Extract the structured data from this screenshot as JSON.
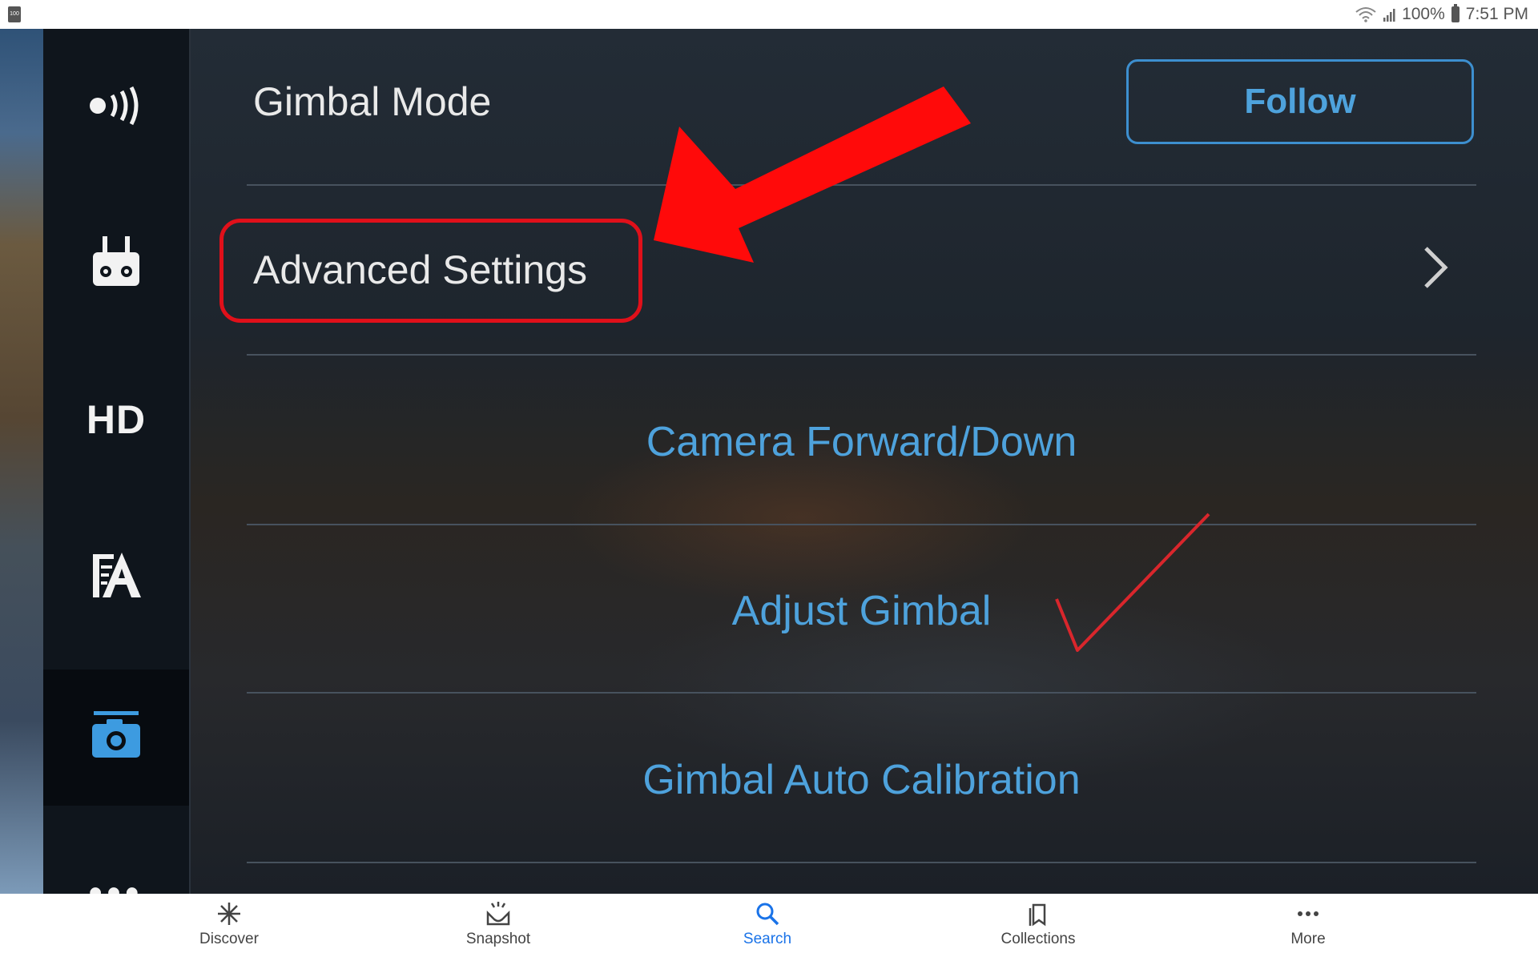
{
  "status_bar": {
    "battery_percent": "100%",
    "time": "7:51 PM",
    "notification_icon_text": "100"
  },
  "sidebar": {
    "items": [
      {
        "icon": "transmission-signal-icon"
      },
      {
        "icon": "remote-controller-icon"
      },
      {
        "icon": "hd-icon",
        "label": "HD"
      },
      {
        "icon": "aircraft-settings-icon"
      },
      {
        "icon": "gimbal-camera-icon",
        "active": true
      },
      {
        "icon": "more-dots-icon",
        "label": "•••"
      }
    ]
  },
  "settings": {
    "gimbal_mode_label": "Gimbal Mode",
    "gimbal_mode_value": "Follow",
    "advanced_settings_label": "Advanced Settings",
    "options": [
      "Camera Forward/Down",
      "Adjust Gimbal",
      "Gimbal Auto Calibration"
    ]
  },
  "annotations": {
    "arrow_color": "#ff0a0a",
    "highlight_color": "#e0101a",
    "checkmark_color": "#d9262c"
  },
  "bottom_nav": {
    "items": [
      {
        "label": "Discover",
        "icon": "asterisk-icon"
      },
      {
        "label": "Snapshot",
        "icon": "snapshot-icon"
      },
      {
        "label": "Search",
        "icon": "search-icon",
        "active": true
      },
      {
        "label": "Collections",
        "icon": "collections-icon"
      },
      {
        "label": "More",
        "icon": "more-icon"
      }
    ],
    "active_color": "#1a73e8"
  }
}
